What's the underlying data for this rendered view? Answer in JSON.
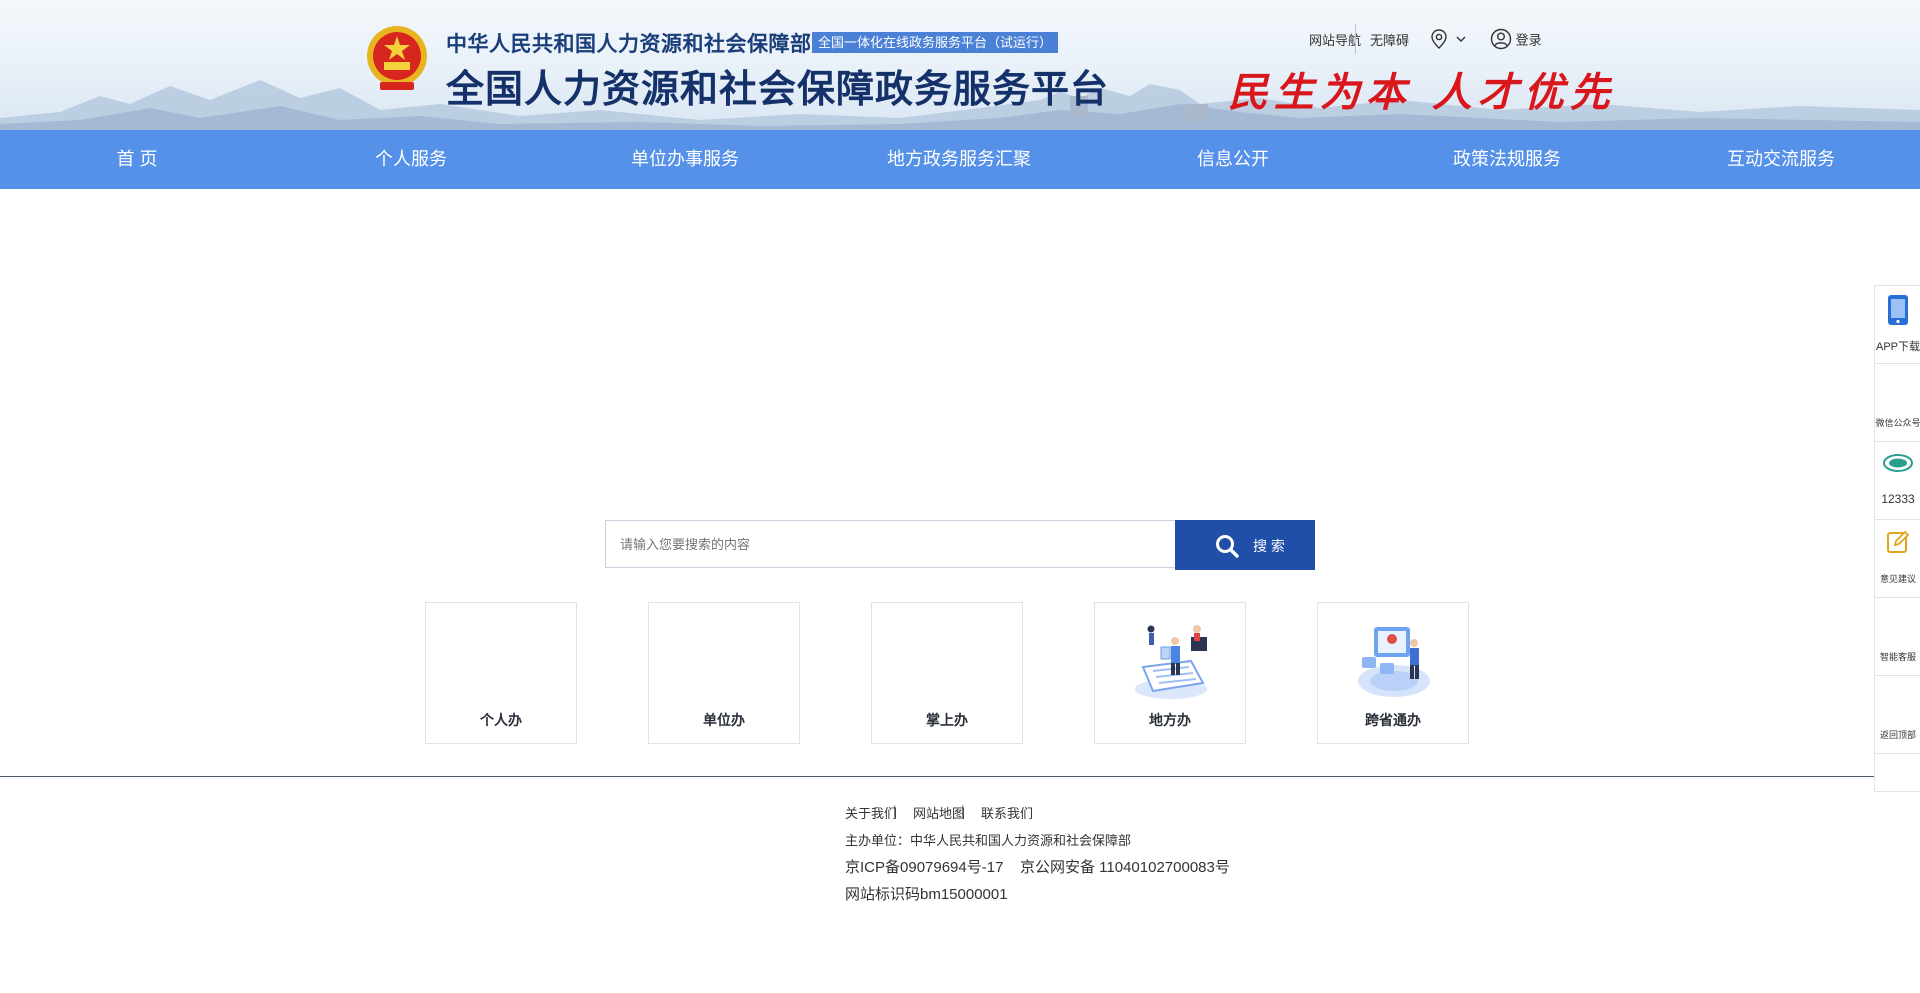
{
  "header": {
    "small_title": "中华人民共和国人力资源和社会保障部",
    "badge": "全国一体化在线政务服务平台（试运行）",
    "big_title": "全国人力资源和社会保障政务服务平台",
    "slogan": "民生为本 人才优先",
    "top_links": [
      "网站导航",
      "无障碍"
    ],
    "location_icon": "map-pin-icon",
    "login_label": "登录",
    "login_icon": "user-icon"
  },
  "nav": {
    "items": [
      "首 页",
      "个人服务",
      "单位办事服务",
      "地方政务服务汇聚",
      "信息公开",
      "政策法规服务",
      "互动交流服务"
    ]
  },
  "search": {
    "placeholder": "请输入您要搜索的内容",
    "button_label": "搜 索"
  },
  "cards": [
    {
      "label": "个人办",
      "icon": "person-service-icon"
    },
    {
      "label": "单位办",
      "icon": "company-service-icon"
    },
    {
      "label": "掌上办",
      "icon": "mobile-service-icon"
    },
    {
      "label": "地方办",
      "icon": "local-service-icon"
    },
    {
      "label": "跨省通办",
      "icon": "cross-province-icon"
    }
  ],
  "footer": {
    "links": [
      "关于我们",
      "网站地图",
      "联系我们"
    ],
    "separator": "|",
    "sponsor": "主办单位：中华人民共和国人力资源和社会保障部",
    "icp": "京ICP备09079694号-17",
    "police": "京公网安备 11040102700083号",
    "site_code": "网站标识码bm15000001"
  },
  "sidebar": {
    "items": [
      {
        "label": "APP下载",
        "icon": "phone-icon"
      },
      {
        "label": "微信公众号",
        "icon": ""
      },
      {
        "label": "12333",
        "icon": "hotline-12333-icon"
      },
      {
        "label": "意见建议",
        "icon": "edit-icon"
      },
      {
        "label": "智能客服",
        "icon": ""
      },
      {
        "label": "返回顶部",
        "icon": ""
      }
    ]
  },
  "colors": {
    "nav_bg": "#5591e8",
    "search_button": "#1f4fa9",
    "title": "#15316a",
    "slogan": "#d8161b",
    "badge": "#4a80d6"
  }
}
